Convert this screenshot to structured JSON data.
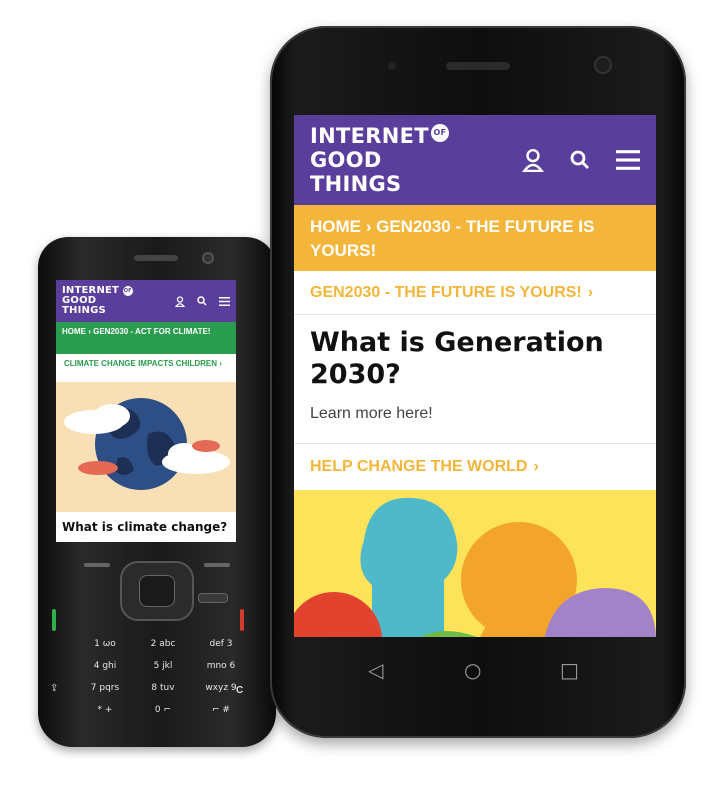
{
  "feature_phone": {
    "header": {
      "logo_line1": "INTERNET",
      "logo_of": "OF",
      "logo_line2": "GOOD THINGS"
    },
    "breadcrumb": "HOME  ›  GEN2030 - ACT FOR CLIMATE!",
    "subsection": "CLIMATE CHANGE IMPACTS CHILDREN",
    "card_title": "What is climate change?",
    "keys": [
      "1 ωο",
      "2 abc",
      "def 3",
      "4 ghi",
      "5 jkl",
      "mno 6",
      "7 pqrs",
      "8 tuv",
      "wxyz 9",
      "* +",
      "0 ⌐",
      "⌐ #"
    ],
    "key_c": "C",
    "key_shift": "⇪"
  },
  "smartphone": {
    "header": {
      "logo_line1": "INTERNET",
      "logo_of": "OF",
      "logo_line2": "GOOD THINGS"
    },
    "breadcrumb": "HOME  ›  GEN2030 - THE FUTURE IS YOURS!",
    "subsection": "GEN2030 - THE FUTURE IS YOURS!",
    "title": "What is Generation 2030?",
    "learn_more": "Learn more here!",
    "help_link": "HELP CHANGE THE WORLD",
    "nav": {
      "back": "◁",
      "home": "○",
      "recents": "□"
    }
  },
  "colors": {
    "brand_purple": "#5a3e9b",
    "accent_yellow": "#f3b53a",
    "accent_green": "#2a9c4e"
  }
}
